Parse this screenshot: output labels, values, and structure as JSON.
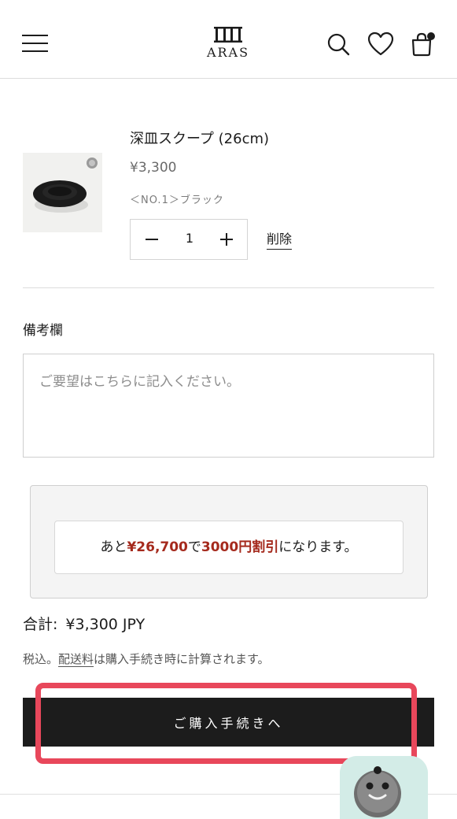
{
  "header": {
    "logo_text": "ARAS",
    "icons": [
      "menu-icon",
      "search-icon",
      "heart-icon",
      "cart-icon"
    ]
  },
  "cart_item": {
    "name": "深皿スクープ (26cm)",
    "price": "¥3,300",
    "variant": "＜NO.1＞ブラック",
    "quantity": "1",
    "remove_label": "削除"
  },
  "notes": {
    "label": "備考欄",
    "placeholder": "ご要望はこちらに記入ください。"
  },
  "promo": {
    "prefix": "あと",
    "amount": "¥26,700",
    "middle": "で",
    "discount": "3000円割引",
    "suffix": "になります。",
    "highlight_color": "#a52a1d"
  },
  "summary": {
    "total_label": "合計:",
    "total_value": "¥3,300 JPY",
    "tax_prefix": "税込。",
    "shipping_link": "配送料",
    "tax_suffix": "は購入手続き時に計算されます。"
  },
  "checkout": {
    "button_label": "ご購入手続きへ",
    "button_color": "#1c1c1c",
    "highlight_color": "#e8475b"
  },
  "chat_widget": {
    "icon": "chatbot-avatar-icon",
    "background": "#d3ece7"
  }
}
